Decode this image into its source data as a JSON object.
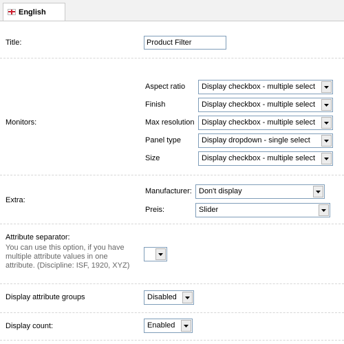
{
  "tabs": [
    {
      "label": "English",
      "icon": "english-flag-icon"
    }
  ],
  "title_row": {
    "label": "Title:",
    "value": "Product Filter"
  },
  "monitors": {
    "label": "Monitors:",
    "items": [
      {
        "label": "Aspect ratio",
        "value": "Display checkbox - multiple select"
      },
      {
        "label": "Finish",
        "value": "Display checkbox - multiple select"
      },
      {
        "label": "Max resolution",
        "value": "Display checkbox - multiple select"
      },
      {
        "label": "Panel type",
        "value": "Display dropdown - single select"
      },
      {
        "label": "Size",
        "value": "Display checkbox - multiple select"
      }
    ]
  },
  "extra": {
    "label": "Extra:",
    "items": [
      {
        "label": "Manufacturer:",
        "value": "Don't display"
      },
      {
        "label": "Preis:",
        "value": "Slider"
      }
    ]
  },
  "separator": {
    "label": "Attribute separator:",
    "help": "You can use this option, if you have multiple attribute values in one attribute. (Discipline: ISF, 1920, XYZ)",
    "value": ""
  },
  "groups": {
    "label": "Display attribute groups",
    "value": "Disabled"
  },
  "count": {
    "label": "Display count:",
    "value": "Enabled"
  }
}
